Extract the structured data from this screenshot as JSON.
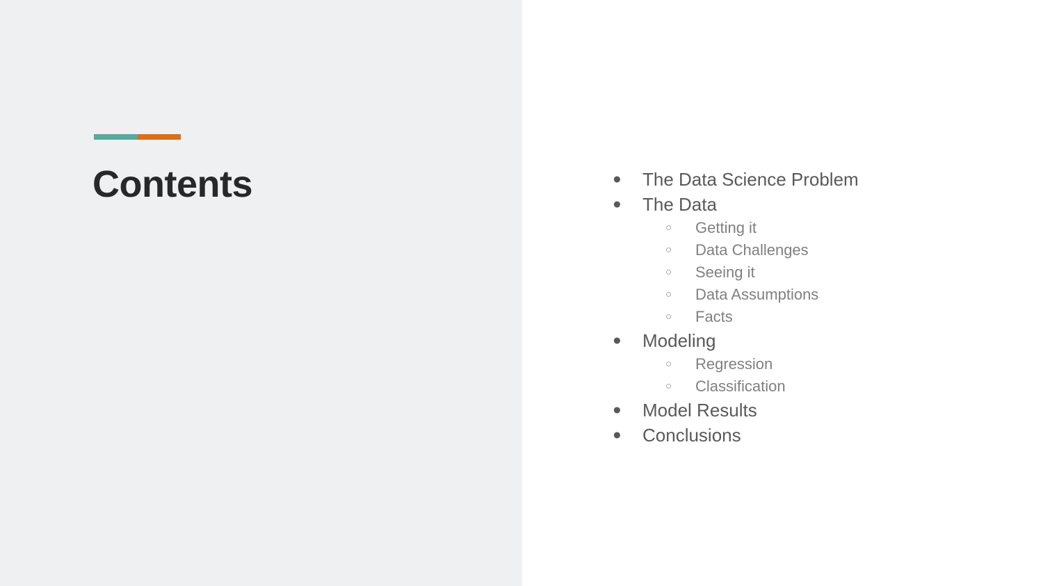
{
  "slide": {
    "title": "Contents",
    "accent": {
      "teal_color": "#5aa79b",
      "orange_color": "#d9701a"
    },
    "colors": {
      "left_panel_background": "#eff0f1",
      "right_panel_background": "#ffffff",
      "title_text": "#26282a",
      "level_1_text": "#595959",
      "level_2_text": "#808080"
    }
  },
  "contents": {
    "items": [
      {
        "level": 1,
        "bullet": "filled-disc-bullet",
        "marker": "●",
        "label": "The Data Science Problem"
      },
      {
        "level": 1,
        "bullet": "filled-disc-bullet",
        "marker": "●",
        "label": "The Data"
      },
      {
        "level": 2,
        "bullet": "hollow-circle-bullet",
        "marker": "○",
        "label": "Getting it"
      },
      {
        "level": 2,
        "bullet": "hollow-circle-bullet",
        "marker": "○",
        "label": "Data Challenges"
      },
      {
        "level": 2,
        "bullet": "hollow-circle-bullet",
        "marker": "○",
        "label": "Seeing it"
      },
      {
        "level": 2,
        "bullet": "hollow-circle-bullet",
        "marker": "○",
        "label": "Data Assumptions"
      },
      {
        "level": 2,
        "bullet": "hollow-circle-bullet",
        "marker": "○",
        "label": "Facts"
      },
      {
        "level": 1,
        "bullet": "filled-disc-bullet",
        "marker": "●",
        "label": "Modeling"
      },
      {
        "level": 2,
        "bullet": "hollow-circle-bullet",
        "marker": "○",
        "label": "Regression"
      },
      {
        "level": 2,
        "bullet": "hollow-circle-bullet",
        "marker": "○",
        "label": "Classification"
      },
      {
        "level": 1,
        "bullet": "filled-disc-bullet",
        "marker": "●",
        "label": "Model Results"
      },
      {
        "level": 1,
        "bullet": "filled-disc-bullet",
        "marker": "●",
        "label": "Conclusions"
      }
    ]
  }
}
